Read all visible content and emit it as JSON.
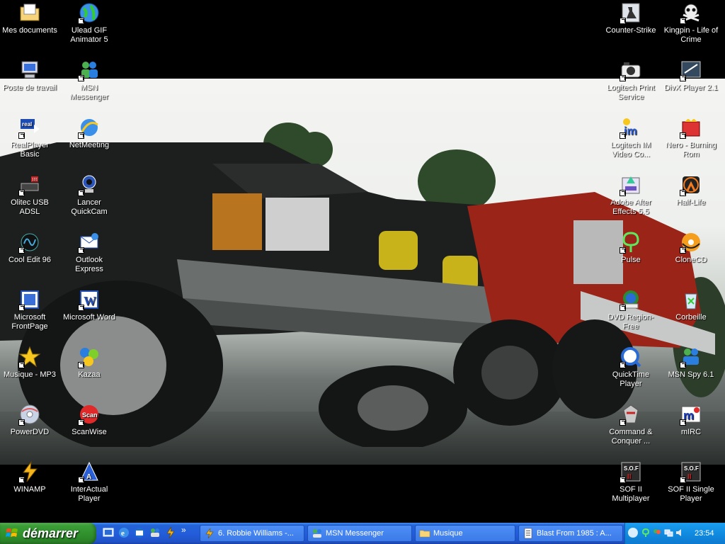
{
  "desktop": {
    "left_column_1": [
      {
        "label": "Mes documents",
        "icon": "folder-documents-icon"
      },
      {
        "label": "Poste de travail",
        "icon": "computer-icon"
      },
      {
        "label": "RealPlayer Basic",
        "icon": "realplayer-icon"
      },
      {
        "label": "Olitec USB ADSL",
        "icon": "modem-icon"
      },
      {
        "label": "Cool Edit 96",
        "icon": "cool-edit-icon"
      },
      {
        "label": "Microsoft FrontPage",
        "icon": "frontpage-icon"
      },
      {
        "label": "Musique - MP3",
        "icon": "star-icon"
      },
      {
        "label": "PowerDVD",
        "icon": "dvd-disc-icon"
      },
      {
        "label": "WINAMP",
        "icon": "winamp-icon"
      }
    ],
    "left_column_2": [
      {
        "label": "Ulead GIF Animator 5",
        "icon": "globe-icon"
      },
      {
        "label": "MSN Messenger",
        "icon": "msn-buddies-icon"
      },
      {
        "label": "NetMeeting",
        "icon": "netmeeting-icon"
      },
      {
        "label": "Lancer QuickCam",
        "icon": "webcam-icon"
      },
      {
        "label": "Outlook Express",
        "icon": "outlook-express-icon"
      },
      {
        "label": "Microsoft Word",
        "icon": "word-icon"
      },
      {
        "label": "Kazaa",
        "icon": "kazaa-icon"
      },
      {
        "label": "ScanWise",
        "icon": "scanwise-icon"
      },
      {
        "label": "InterActual Player",
        "icon": "interactual-icon"
      }
    ],
    "right_column_1": [
      {
        "label": "Counter-Strike",
        "icon": "counter-strike-icon"
      },
      {
        "label": "Logitech Print Service",
        "icon": "camera-icon"
      },
      {
        "label": "Logitech IM Video Co...",
        "icon": "im-video-icon"
      },
      {
        "label": "Adobe After Effects 5.5",
        "icon": "after-effects-icon"
      },
      {
        "label": "Pulse",
        "icon": "pulse-icon"
      },
      {
        "label": "DVD Region-Free",
        "icon": "dvd-region-icon"
      },
      {
        "label": "QuickTime Player",
        "icon": "quicktime-icon"
      },
      {
        "label": "Command & Conquer ...",
        "icon": "command-conquer-icon"
      },
      {
        "label": "SOF II Multiplayer",
        "icon": "sof-icon"
      }
    ],
    "right_column_2": [
      {
        "label": "Kingpin - Life of Crime",
        "icon": "skull-icon"
      },
      {
        "label": "DivX Player 2.1",
        "icon": "divx-icon"
      },
      {
        "label": "Nero - Burning Rom",
        "icon": "nero-icon"
      },
      {
        "label": "Half-Life",
        "icon": "half-life-icon"
      },
      {
        "label": "CloneCD",
        "icon": "clonecd-icon"
      },
      {
        "label": "Corbeille",
        "icon": "recycle-bin-icon"
      },
      {
        "label": "MSN Spy 6.1",
        "icon": "msn-spy-icon"
      },
      {
        "label": "mIRC",
        "icon": "mirc-icon"
      },
      {
        "label": "SOF II Single Player",
        "icon": "sof-icon"
      }
    ]
  },
  "taskbar": {
    "start_label": "démarrer",
    "quick_launch": [
      "desktop-icon",
      "ie-icon",
      "outlook-icon",
      "winamp-icon"
    ],
    "more_label": "»",
    "tasks": [
      {
        "label": "6. Robbie Williams -...",
        "icon": "winamp-icon",
        "active": false
      },
      {
        "label": "MSN Messenger",
        "icon": "msn-icon",
        "active": false
      },
      {
        "label": "Musique",
        "icon": "folder-icon",
        "active": false
      },
      {
        "label": "Blast From 1985 : A...",
        "icon": "document-icon",
        "active": false
      }
    ],
    "clock": "23:54"
  },
  "colors": {
    "taskbar": "#245edb",
    "start_green": "#3a9d36",
    "tray": "#108be0",
    "desktop": "#000000"
  }
}
